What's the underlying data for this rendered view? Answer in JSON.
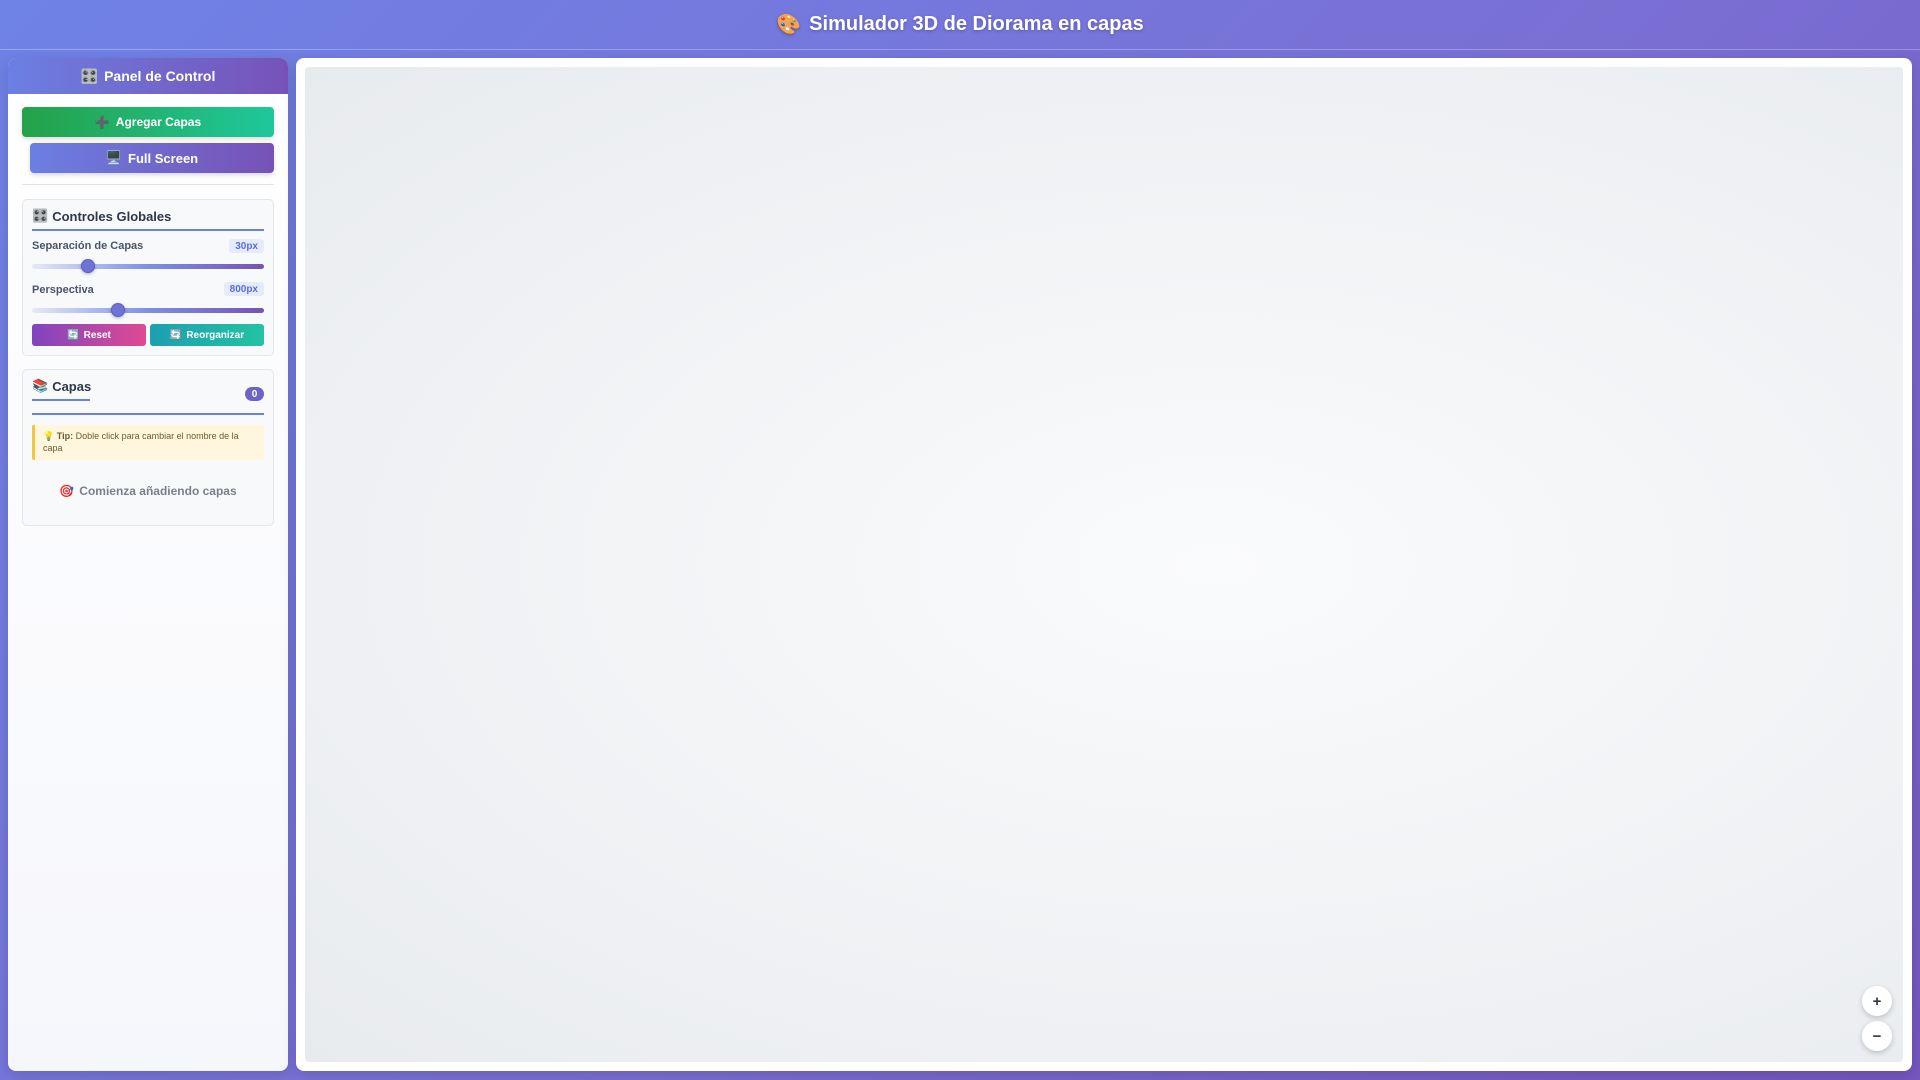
{
  "header": {
    "icon": "🎨",
    "title": "Simulador 3D de Diorama en capas"
  },
  "sidebar": {
    "title_icon": "🎛️",
    "title": "Panel de Control",
    "add_layers": {
      "icon": "➕",
      "label": "Agregar Capas"
    },
    "fullscreen": {
      "icon": "🖥️",
      "label": "Full Screen"
    }
  },
  "global_controls": {
    "title_icon": "🎛️",
    "title": "Controles Globales",
    "separation": {
      "label": "Separación de Capas",
      "value_text": "30px",
      "fraction": 0.24
    },
    "perspective": {
      "label": "Perspectiva",
      "value_text": "800px",
      "fraction": 0.37
    },
    "reset": {
      "icon": "🔄",
      "label": "Reset"
    },
    "reorganize": {
      "icon": "🔄",
      "label": "Reorganizar"
    }
  },
  "layers": {
    "title_icon": "📚",
    "title": "Capas",
    "count": "0",
    "tip_icon": "💡",
    "tip_label": "Tip:",
    "tip_text": "Doble click para cambiar el nombre de la capa",
    "empty_icon": "🎯",
    "empty_text": "Comienza añadiendo capas"
  },
  "zoom": {
    "in_symbol": "+",
    "out_symbol": "−"
  },
  "colors": {
    "accent": "#6b7fe2",
    "accent_dark": "#7753b8",
    "green": "#23a249",
    "teal": "#1fc79b"
  }
}
